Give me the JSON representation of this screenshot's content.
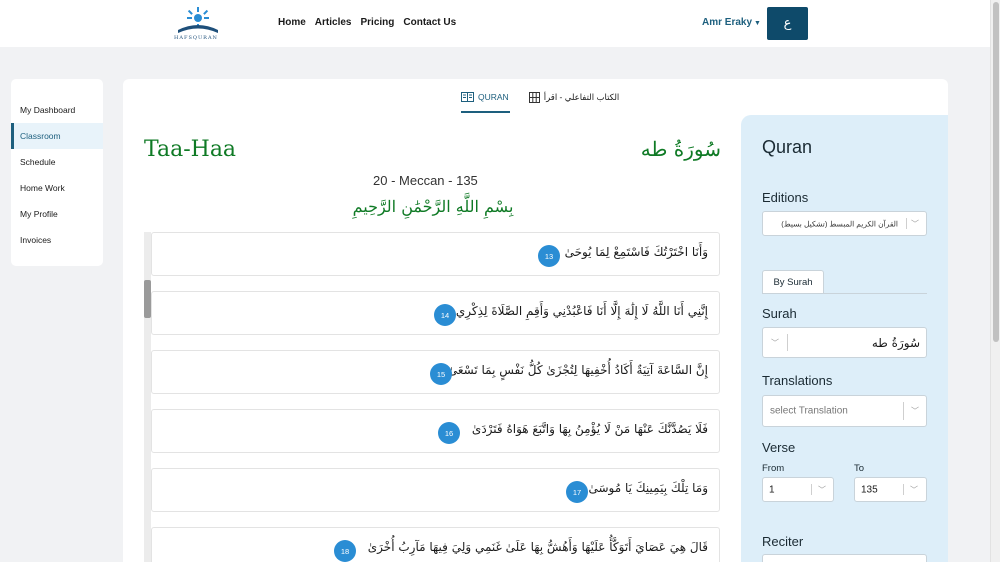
{
  "brand": {
    "logo_text": "HAFSQURAN"
  },
  "nav": {
    "links": [
      "Home",
      "Articles",
      "Pricing",
      "Contact Us"
    ]
  },
  "user": {
    "name": "Amr Eraky",
    "lang_button": "ع"
  },
  "sidebar": {
    "items": [
      {
        "label": "My Dashboard",
        "active": false
      },
      {
        "label": "Classroom",
        "active": true
      },
      {
        "label": "Schedule",
        "active": false
      },
      {
        "label": "Home Work",
        "active": false
      },
      {
        "label": "My Profile",
        "active": false
      },
      {
        "label": "Invoices",
        "active": false
      }
    ]
  },
  "tabs": [
    {
      "label": "QURAN",
      "icon": "book-icon",
      "active": true
    },
    {
      "label": "الكتاب التفاعلي - اقرأ",
      "icon": "grid-book-icon",
      "active": false
    }
  ],
  "surah": {
    "name_en": "Taa-Haa",
    "name_ar": "سُورَةُ طه",
    "meta": "20 - Meccan - 135",
    "basmala": "بِسْمِ اللَّهِ الرَّحْمَٰنِ الرَّحِيمِ"
  },
  "verses": [
    {
      "num": "13",
      "text": "وَأَنَا اخْتَرْتُكَ فَاسْتَمِعْ لِمَا يُوحَىٰ"
    },
    {
      "num": "14",
      "text": "إِنَّنِي أَنَا اللَّهُ لَا إِلَٰهَ إِلَّا أَنَا فَاعْبُدْنِي وَأَقِمِ الصَّلَاةَ لِذِكْرِي"
    },
    {
      "num": "15",
      "text": "إِنَّ السَّاعَةَ آتِيَةٌ أَكَادُ أُخْفِيهَا لِتُجْزَىٰ كُلُّ نَفْسٍ بِمَا تَسْعَىٰ"
    },
    {
      "num": "16",
      "text": "فَلَا يَصُدَّنَّكَ عَنْهَا مَنْ لَا يُؤْمِنُ بِهَا وَاتَّبَعَ هَوَاهُ فَتَرْدَىٰ"
    },
    {
      "num": "17",
      "text": "وَمَا تِلْكَ بِيَمِينِكَ يَا مُوسَىٰ"
    },
    {
      "num": "18",
      "text": "قَالَ هِيَ عَصَايَ أَتَوَكَّأُ عَلَيْهَا وَأَهُشُّ بِهَا عَلَىٰ غَنَمِي وَلِيَ فِيهَا مَآرِبُ أُخْرَىٰ"
    }
  ],
  "panel": {
    "title": "Quran",
    "editions_label": "Editions",
    "edition_value": "القرآن الكريم المبسط (تشكيل بسيط)",
    "by_surah_tab": "By Surah",
    "surah_label": "Surah",
    "surah_value": "سُورَةُ طه",
    "translations_label": "Translations",
    "translation_placeholder": "select Translation",
    "verse_label": "Verse",
    "from_label": "From",
    "from_value": "1",
    "to_label": "To",
    "to_value": "135",
    "reciter_label": "Reciter"
  },
  "colors": {
    "accent": "#1d5f7e",
    "lang_button": "#0e4a6a",
    "quran_green": "#0f7a25",
    "verse_badge": "#2a8dd4",
    "panel_bg": "#ddeef9"
  }
}
